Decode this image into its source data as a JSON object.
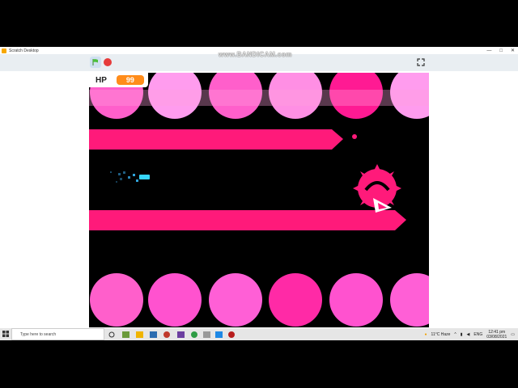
{
  "window": {
    "title": "Scratch Desktop",
    "controls": [
      "—",
      "□",
      "✕"
    ]
  },
  "watermark": "www.BANDICAM.com",
  "toolbar": {
    "green_flag_icon": "green-flag-icon",
    "stop_icon": "stop-icon",
    "fullscreen_icon": "fullscreen-icon"
  },
  "game": {
    "hp_label": "HP",
    "hp_value": "99",
    "colors": {
      "background": "#000000",
      "hazard": "#ff1a7a",
      "circle_light": "#ff7ad0",
      "circle_pale": "#ffa6f0",
      "player": "#37d6ff"
    }
  },
  "taskbar": {
    "search_placeholder": "Type here to search",
    "weather": "11°C  Haze",
    "language": "ENG",
    "time": "12:41 pm",
    "date": "03/08/2021"
  }
}
